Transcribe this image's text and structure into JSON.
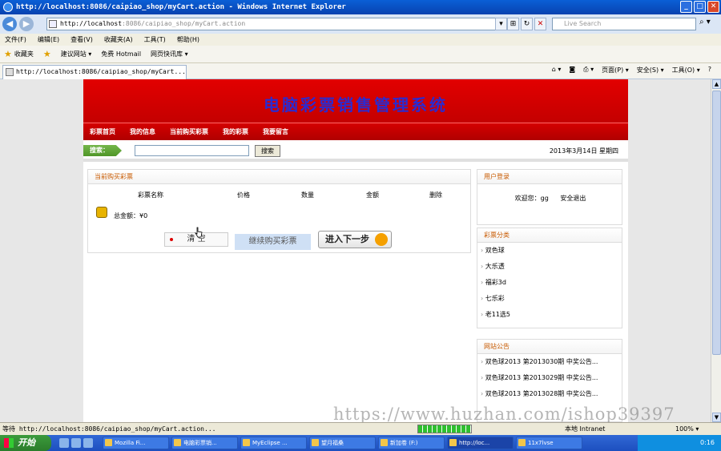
{
  "window": {
    "title": "http://localhost:8086/caipiao_shop/myCart.action - Windows Internet Explorer"
  },
  "address": {
    "url_host": "http://localhost",
    "url_rest": ":8086/caipiao_shop/myCart.action",
    "search_placeholder": "Live Search"
  },
  "menu": [
    "文件(F)",
    "编辑(E)",
    "查看(V)",
    "收藏夹(A)",
    "工具(T)",
    "帮助(H)"
  ],
  "favorites": {
    "label": "收藏夹",
    "items": [
      "建议网站 ▾",
      "免费 Hotmail",
      "网页快讯库 ▾"
    ]
  },
  "tab": {
    "title": "http://localhost:8086/caipiao_shop/myCart..."
  },
  "commands": [
    "页面(P) ▾",
    "安全(S) ▾",
    "工具(O) ▾",
    "?"
  ],
  "site": {
    "banner_title": "电脑彩票销售管理系统",
    "nav": [
      "彩票首页",
      "我的信息",
      "当前购买彩票",
      "我的彩票",
      "我要留言"
    ],
    "search_label": "搜索：",
    "search_button": "搜索",
    "date": "2013年3月14日 星期四",
    "cart": {
      "title": "当前购买彩票",
      "columns": [
        "彩票名称",
        "价格",
        "数量",
        "金额",
        "删除"
      ],
      "total": "总金额：¥0",
      "clear_button": "清 空",
      "continue_button": "继续购买彩票",
      "next_button": "进入下一步"
    },
    "login": {
      "title": "用户登录",
      "welcome": "欢迎您：gg",
      "logout": "安全退出"
    },
    "categories": {
      "title": "彩票分类",
      "items": [
        "双色球",
        "大乐透",
        "福彩3d",
        "七乐彩",
        "老11选5"
      ]
    },
    "notices": {
      "title": "网站公告",
      "items": [
        "双色球2013 第2013030期 中奖公告...",
        "双色球2013 第2013029期 中奖公告...",
        "双色球2013 第2013028期 中奖公告..."
      ]
    }
  },
  "watermark": "https://www.huzhan.com/ishop39397",
  "status": {
    "text": "等待 http://localhost:8086/caipiao_shop/myCart.action...",
    "zone": "本地 Intranet",
    "zoom": "100% ▾",
    "progress": 1.0
  },
  "taskbar": {
    "start": "开始",
    "tasks": [
      "Mozilla Fi...",
      "电脑彩票销...",
      "MyEclipse ...",
      "望月福桑",
      "新加卷 (F:)",
      "http://loc...",
      "11x7lvse"
    ],
    "clock": "0:16"
  }
}
